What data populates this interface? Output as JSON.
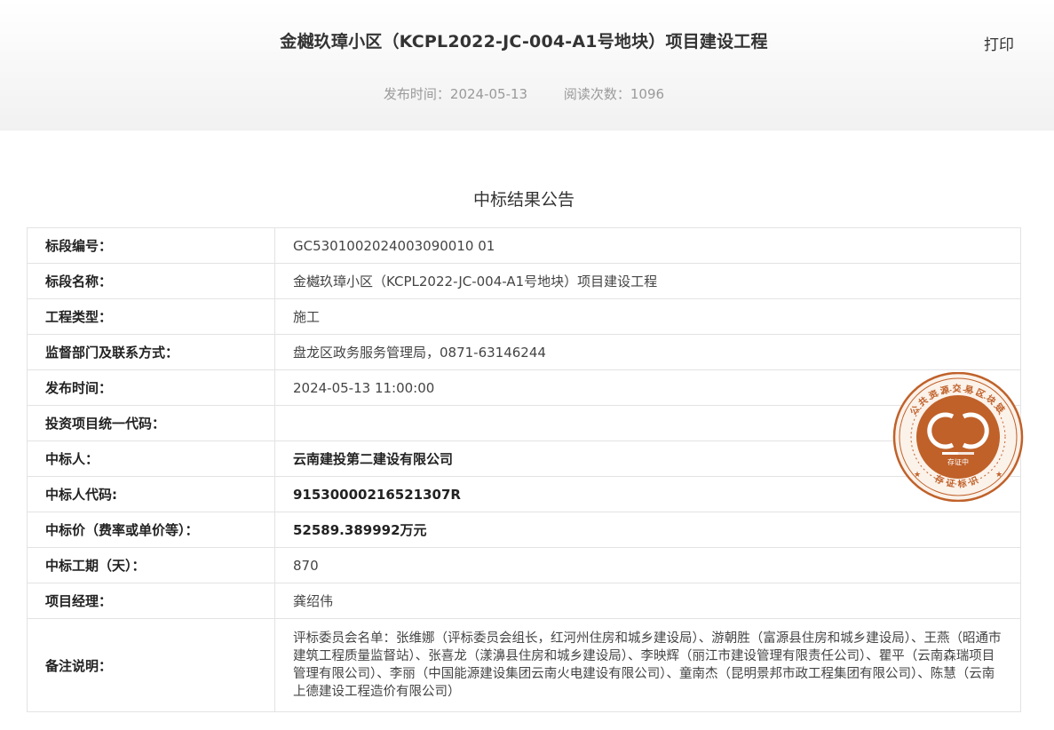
{
  "header": {
    "title": "金樾玖璋小区（KCPL2022-JC-004-A1号地块）项目建设工程",
    "print_label": "打印",
    "publish_time": "发布时间：2024-05-13",
    "read_count": "阅读次数：1096"
  },
  "subtitle": "中标结果公告",
  "rows": [
    {
      "label": "标段编号：",
      "value": "GC5301002024003090010 01"
    },
    {
      "label": "标段名称：",
      "value": "金樾玖璋小区（KCPL2022-JC-004-A1号地块）项目建设工程"
    },
    {
      "label": "工程类型：",
      "value": "施工"
    },
    {
      "label": "监督部门及联系方式：",
      "value": "盘龙区政务服务管理局，0871-63146244"
    },
    {
      "label": "发布时间：",
      "value": "2024-05-13 11:00:00"
    },
    {
      "label": "投资项目统一代码：",
      "value": ""
    },
    {
      "label": "中标人：",
      "value": "云南建投第二建设有限公司"
    },
    {
      "label": "中标人代码:",
      "value": "91530000216521307R"
    },
    {
      "label": "中标价（费率或单价等）：",
      "value": "52589.389992万元"
    },
    {
      "label": "中标工期（天）：",
      "value": "870"
    },
    {
      "label": "项目经理：",
      "value": "龚绍伟"
    },
    {
      "label": "备注说明：",
      "value": "评标委员会名单：张维娜（评标委员会组长，红河州住房和城乡建设局）、游朝胜（富源县住房和城乡建设局）、王燕（昭通市建筑工程质量监督站）、张喜龙（漾濞县住房和城乡建设局）、李映辉（丽江市建设管理有限责任公司）、瞿平（云南森瑞项目管理有限公司）、李丽（中国能源建设集团云南火电建设有限公司）、童南杰（昆明景邦市政工程集团有限公司）、陈慧（云南上德建设工程造价有限公司）"
    }
  ],
  "seal": {
    "ring_text": "公共资源交易区块链",
    "inner_text": "存证中",
    "bottom_text": "存证标识",
    "color": "#c0612a"
  }
}
